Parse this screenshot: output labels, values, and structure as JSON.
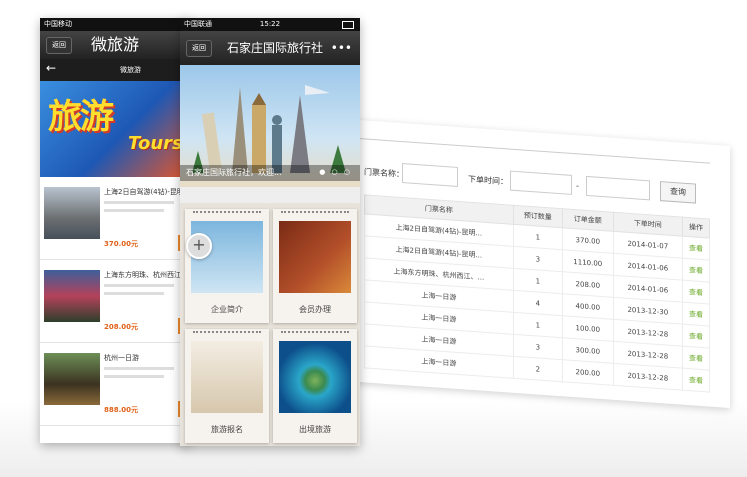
{
  "admin": {
    "filter": {
      "ticket_name_label": "门票名称：",
      "order_time_label": "下单时间：",
      "range_separator": "-",
      "search_button": "查询"
    },
    "table": {
      "headers": [
        "门票名称",
        "预订数量",
        "订单金额",
        "下单时间",
        "操作"
      ],
      "rows": [
        {
          "name": "上海2日自驾游(4钻)-昆明...",
          "qty": "1",
          "amount": "370.00",
          "date": "2014-01-07",
          "action": "查看"
        },
        {
          "name": "上海2日自驾游(4钻)-昆明...",
          "qty": "3",
          "amount": "1110.00",
          "date": "2014-01-06",
          "action": "查看"
        },
        {
          "name": "上海东方明珠、杭州西江、...",
          "qty": "1",
          "amount": "208.00",
          "date": "2014-01-06",
          "action": "查看"
        },
        {
          "name": "上海一日游",
          "qty": "4",
          "amount": "400.00",
          "date": "2013-12-30",
          "action": "查看"
        },
        {
          "name": "上海一日游",
          "qty": "1",
          "amount": "100.00",
          "date": "2013-12-28",
          "action": "查看"
        },
        {
          "name": "上海一日游",
          "qty": "3",
          "amount": "300.00",
          "date": "2013-12-28",
          "action": "查看"
        },
        {
          "name": "上海一日游",
          "qty": "2",
          "amount": "200.00",
          "date": "2013-12-28",
          "action": "查看"
        }
      ]
    }
  },
  "phone1": {
    "carrier": "中国移动",
    "back_label": "返回",
    "title": "微旅游",
    "sub_label": "微旅游",
    "banner_text": "旅游",
    "banner_sub": "Tours",
    "items": [
      {
        "title": "上海2日自驾游(4钻)-昆明",
        "price": "370.00元"
      },
      {
        "title": "上海东方明珠、杭州西江",
        "price": "208.00元"
      },
      {
        "title": "杭州一日游",
        "price": "888.00元"
      }
    ]
  },
  "phone2": {
    "carrier": "中国联通",
    "time": "15:22",
    "back_label": "返回",
    "title": "石家庄国际旅行社",
    "more_icon": "•••",
    "banner_caption": "石家庄国际旅行社，欢迎...",
    "tiles": [
      {
        "label": "企业简介"
      },
      {
        "label": "会员办理"
      },
      {
        "label": "旅游报名"
      },
      {
        "label": "出境旅游"
      }
    ],
    "fab_label": "+"
  }
}
